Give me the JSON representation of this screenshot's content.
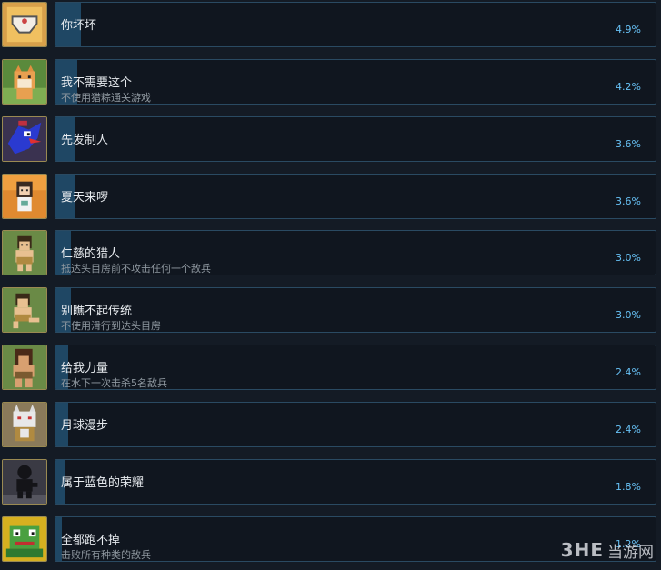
{
  "achievements": [
    {
      "title": "你坏坏",
      "description": "",
      "percent": "4.9%",
      "progress": 4.9,
      "icon": "underwear-icon",
      "icon_bg": "#d8a04a"
    },
    {
      "title": "我不需要这个",
      "description": "不使用猎粽通关游戏",
      "percent": "4.2%",
      "progress": 4.2,
      "icon": "shiba-dog-icon",
      "icon_bg": "#5a8a3c"
    },
    {
      "title": "先发制人",
      "description": "",
      "percent": "3.6%",
      "progress": 3.6,
      "icon": "blue-bird-icon",
      "icon_bg": "#3a3250"
    },
    {
      "title": "夏天来啰",
      "description": "",
      "percent": "3.6%",
      "progress": 3.6,
      "icon": "girl-summer-icon",
      "icon_bg": "#e08a30"
    },
    {
      "title": "仁慈的猎人",
      "description": "抵达头目房前不攻击任何一个敌兵",
      "percent": "3.0%",
      "progress": 3.0,
      "icon": "hunter-icon",
      "icon_bg": "#6a8a46"
    },
    {
      "title": "别瞧不起传统",
      "description": "不使用滑行到达头目房",
      "percent": "3.0%",
      "progress": 3.0,
      "icon": "hunter-kick-icon",
      "icon_bg": "#6a8a46"
    },
    {
      "title": "给我力量",
      "description": "在水下一次击杀5名敌兵",
      "percent": "2.4%",
      "progress": 2.4,
      "icon": "warrior-icon",
      "icon_bg": "#6a8a46"
    },
    {
      "title": "月球漫步",
      "description": "",
      "percent": "2.4%",
      "progress": 2.4,
      "icon": "cat-warrior-icon",
      "icon_bg": "#8a7a5a"
    },
    {
      "title": "属于蓝色的荣耀",
      "description": "",
      "percent": "1.8%",
      "progress": 1.8,
      "icon": "shadow-figure-icon",
      "icon_bg": "#3a3a44"
    },
    {
      "title": "全都跑不掉",
      "description": "击败所有种类的敌兵",
      "percent": "1.2%",
      "progress": 1.2,
      "icon": "frog-monster-icon",
      "icon_bg": "#c8a020"
    }
  ],
  "watermark": {
    "logo": "3HE",
    "text": "当游网"
  }
}
